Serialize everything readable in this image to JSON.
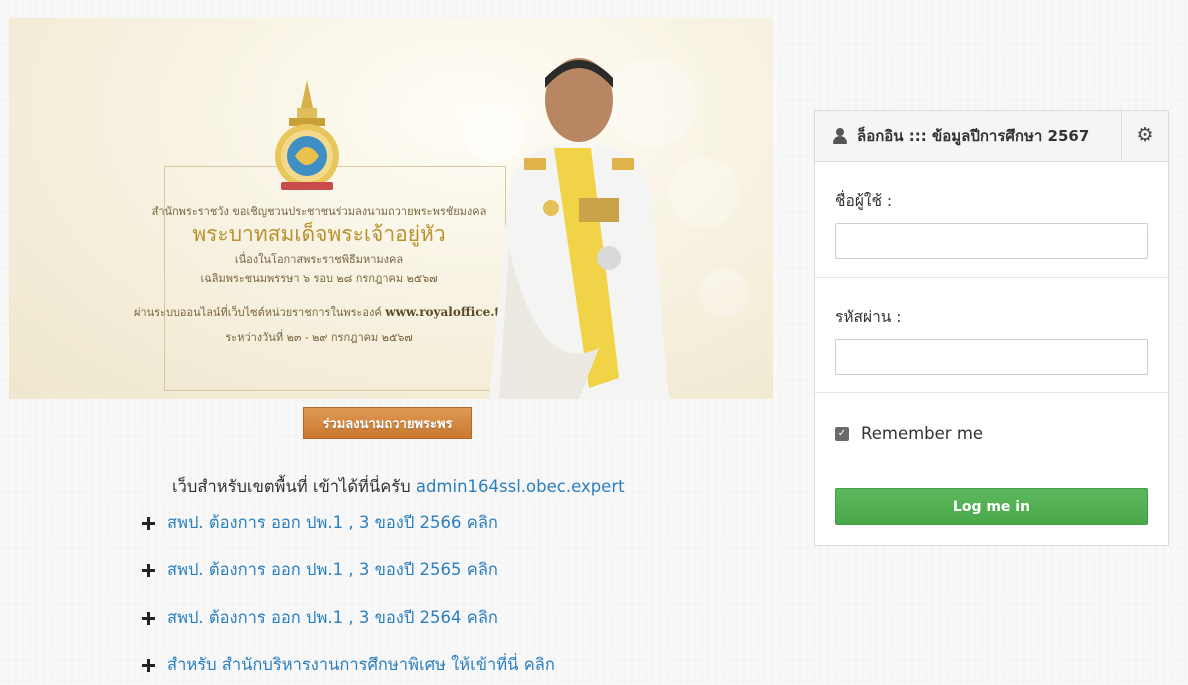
{
  "banner": {
    "line1": "สำนักพระราชวัง ขอเชิญชวนประชาชนร่วมลงนามถวายพระพรชัยมงคล",
    "line2": "พระบาทสมเด็จพระเจ้าอยู่หัว",
    "line3": "เนื่องในโอกาสพระราชพิธีมหามงคล",
    "line4": "เฉลิมพระชนมพรรษา ๖ รอบ ๒๘ กรกฎาคม ๒๕๖๗",
    "line5_prefix": "ผ่านระบบออนไลน์ที่เว็บไซต์หน่วยราชการในพระองค์",
    "line5_site": "www.royaloffice.th",
    "line6": "ระหว่างวันที่ ๒๓ - ๒๙ กรกฎาคม ๒๕๖๗"
  },
  "sign_button": "ร่วมลงนามถวายพระพร",
  "notice": {
    "text": "เว็บสำหรับเขตพื้นที่ เข้าได้ที่นี่ครับ",
    "link": "admin164ssl.obec.expert"
  },
  "links": [
    "สพป. ต้องการ ออก ปพ.1 , 3  ของปี 2566 คลิก",
    "สพป. ต้องการ ออก ปพ.1 , 3  ของปี 2565 คลิก",
    "สพป. ต้องการ ออก ปพ.1 , 3  ของปี 2564 คลิก",
    "สำหรับ สำนักบริหารงานการศึกษาพิเศษ ให้เข้าที่นี่ คลิก"
  ],
  "login": {
    "title": "ล็อกอิน ::: ข้อมูลปีการศึกษา 2567",
    "username_label": "ชื่อผู้ใช้ :",
    "username_value": "",
    "password_label": "รหัสผ่าน :",
    "password_value": "",
    "remember_label": "Remember me",
    "remember_checked": true,
    "submit_label": "Log me in"
  },
  "icons": {
    "user": "user-icon",
    "settings": "gear-icon",
    "expand": "plus-icon",
    "check": "check-icon"
  },
  "colors": {
    "link": "#2a7fbf",
    "login_button": "#5cb85c",
    "sign_button": "#d98a40",
    "banner_gold": "#b8912f"
  }
}
